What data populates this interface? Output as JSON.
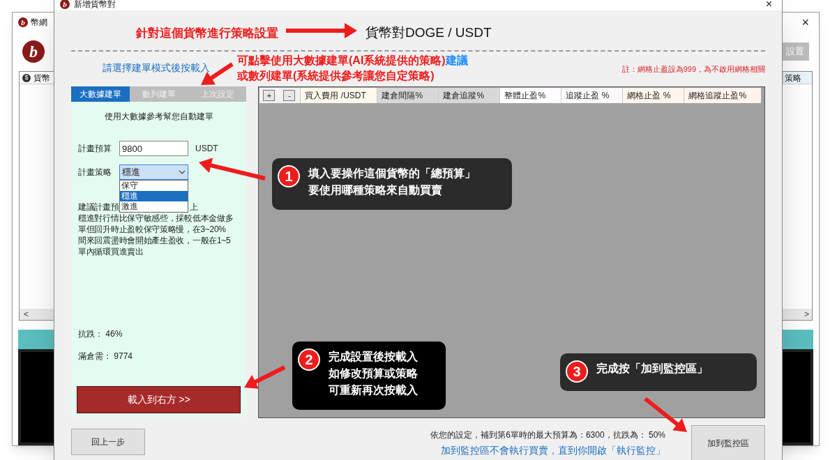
{
  "background_window": {
    "title_icon": "b",
    "title": "幣網",
    "logo": "b",
    "coin_symbol": "$",
    "column_1": "貨幣",
    "column_2": "策略",
    "settings_button": "設置",
    "scroll_left": "<",
    "scroll_right": ">",
    "close": "×"
  },
  "dialog": {
    "title_icon": "b",
    "title": "新增貨幣對",
    "close": "×",
    "pair_heading": "貨幣對DOGE / USDT",
    "prompt": "請選擇建單模式後按載入",
    "note": "註：網格止盈設為999，為不啟用網格相關",
    "tabs": [
      {
        "label": "大數據建單",
        "selected": true
      },
      {
        "label": "數列建單",
        "selected": false
      },
      {
        "label": "上次設定",
        "selected": false
      }
    ],
    "panel": {
      "intro": "使用大數據參考幫您自動建單",
      "budget_label": "計畫預算",
      "budget_value": "9800",
      "budget_unit": "USDT",
      "strategy_label": "計畫策略",
      "strategy_value": "穩進",
      "strategy_options": [
        {
          "label": "保守",
          "selected": false
        },
        {
          "label": "穩進",
          "selected": true
        },
        {
          "label": "激進",
          "selected": false
        }
      ],
      "description_start": "建議計畫預",
      "description_end": "上",
      "description_lines": [
        "穩進對行情比保守敏感些，採較低本金做多",
        "單但回升時止盈較保守策略慢，在3~20%",
        "間來回震盪時會開始產生盈收，一般在1~5",
        "單內循環買進賣出"
      ],
      "drop_resistance": "抗跌： 46%",
      "full_position": "滿倉需： 9774",
      "load_button": "載入到右方 >>"
    },
    "grid": {
      "add_button": "+",
      "remove_button": "-",
      "columns": [
        {
          "label": "買入費用 /USDT",
          "color": "#fff8ec"
        },
        {
          "label": "建倉間隔%",
          "color": "#d8d8d8"
        },
        {
          "label": "建倉追蹤%",
          "color": "#d8d8d8"
        },
        {
          "label": "整體止盈%",
          "color": "#fefcff"
        },
        {
          "label": "追蹤止盈 %",
          "color": "#fdf8fc"
        },
        {
          "label": "網格止盈 %",
          "color": "#fff5ec"
        },
        {
          "label": "網格追蹤止盈%",
          "color": "#fff3ec"
        }
      ]
    },
    "summary": "依您的設定，補到第6單時的最大預算為：6300，抗跌為： 50%",
    "hint": "加到監控區不會執行買賣，直到你開啟「執行監控」",
    "back_button": "回上一步",
    "add_monitor_button": "加到監控區"
  },
  "annotations": {
    "top_label": "針對這個貨幣進行策略設置",
    "mode_hint_1": "可點擊使用大數據建單(AI系統提供的策略)",
    "mode_hint_highlight": "建議",
    "mode_hint_2": "或數列建單(系統提供參考讓您自定策略)",
    "callouts": [
      {
        "number": "1",
        "lines": [
          "填入要操作這個貨幣的「總預算」",
          "要使用哪種策略來自動買賣"
        ]
      },
      {
        "number": "2",
        "lines": [
          "完成設置後按載入",
          "如修改預算或策略",
          "可重新再次按載入"
        ]
      },
      {
        "number": "3",
        "lines": [
          "完成按「加到監控區」"
        ]
      }
    ]
  }
}
